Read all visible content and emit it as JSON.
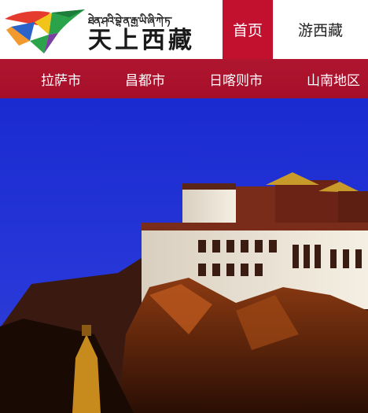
{
  "header": {
    "logo": {
      "tibetan_text": "ཐེན་ཤའི་བྷེ་ན་རྒྱ་ཡི་ཞི་ཀེ་ཏ་",
      "chinese_text": "天上西藏"
    },
    "tabs": [
      {
        "label": "首页",
        "active": true
      },
      {
        "label": "游西藏",
        "active": false
      }
    ]
  },
  "subnav": {
    "items": [
      {
        "label": "拉萨市"
      },
      {
        "label": "昌都市"
      },
      {
        "label": "日喀则市"
      },
      {
        "label": "山南地区"
      }
    ]
  },
  "colors": {
    "accent": "#c2102f",
    "subnav_bg": "#a8112c",
    "sky": "#1f2fd6"
  },
  "hero": {
    "image_subject": "potala-palace"
  }
}
